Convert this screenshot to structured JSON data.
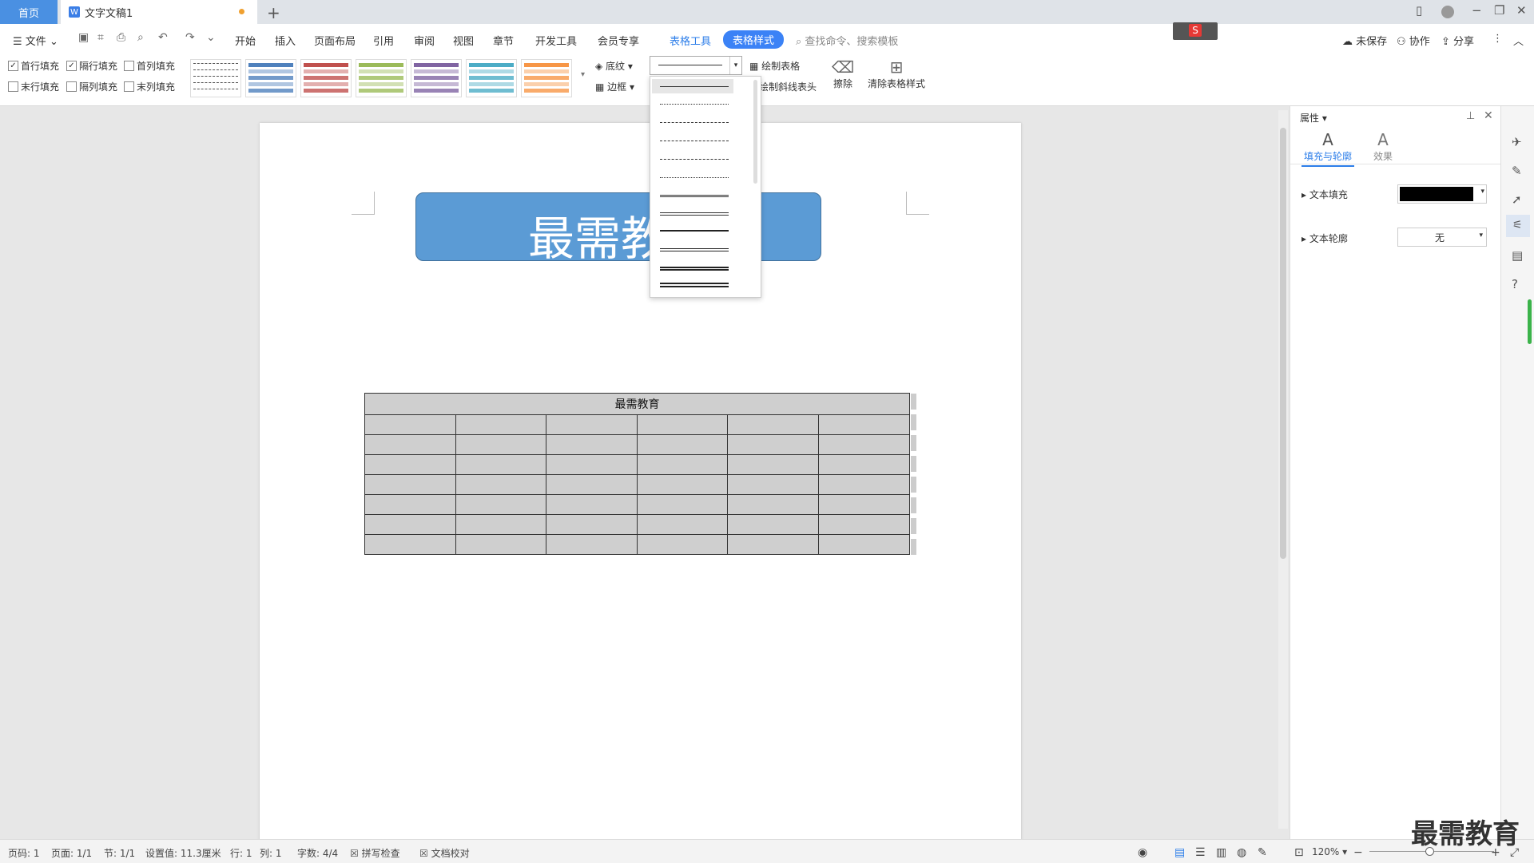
{
  "tabs": {
    "home": "首页",
    "doc": "文字文稿1",
    "doc_icon": "W"
  },
  "menu": {
    "file": "文件",
    "items": [
      "开始",
      "插入",
      "页面布局",
      "引用",
      "审阅",
      "视图",
      "章节",
      "开发工具",
      "会员专享"
    ],
    "table_tools": "表格工具",
    "table_style": "表格样式",
    "search_placeholder": "查找命令、搜索模板",
    "unsaved": "未保存",
    "collab": "协作",
    "share": "分享"
  },
  "ribbon": {
    "checkboxes": [
      {
        "label": "首行填充",
        "checked": true
      },
      {
        "label": "隔行填充",
        "checked": true
      },
      {
        "label": "首列填充",
        "checked": false
      },
      {
        "label": "末行填充",
        "checked": false
      },
      {
        "label": "隔列填充",
        "checked": false
      },
      {
        "label": "末列填充",
        "checked": false
      }
    ],
    "style_colors": [
      "#ffffff",
      "#4f81bd",
      "#c0504d",
      "#9bbb59",
      "#8064a2",
      "#4bacc6",
      "#f79646"
    ],
    "shading": "底纹",
    "border": "边框",
    "draw_table": "绘制表格",
    "draw_diag": "绘制斜线表头",
    "erase": "擦除",
    "clear_style": "清除表格样式"
  },
  "document": {
    "banner_text": "最需教",
    "table_header": "最需教育",
    "table_rows": 7,
    "table_cols": 6
  },
  "panel": {
    "title": "属性",
    "tab_fill": "填充与轮廓",
    "tab_effect": "效果",
    "text_fill": "文本填充",
    "text_outline": "文本轮廓",
    "outline_value": "无",
    "fill_color": "#000000"
  },
  "status": {
    "page_num": "页码: 1",
    "pages": "页面: 1/1",
    "section": "节: 1/1",
    "setting": "设置值: 11.3厘米",
    "row": "行: 1",
    "col": "列: 1",
    "words": "字数: 4/4",
    "spell": "拼写检查",
    "proof": "文档校对",
    "zoom": "120%"
  },
  "watermark": "最需教育"
}
